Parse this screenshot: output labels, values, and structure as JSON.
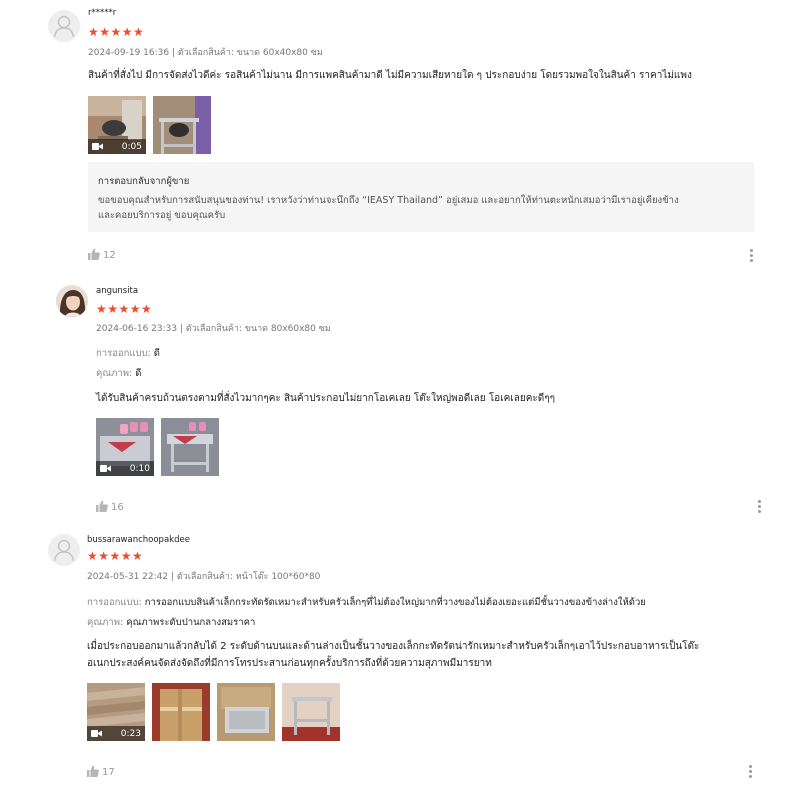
{
  "reviews": [
    {
      "username": "r*****r",
      "stars": "★★★★★",
      "meta": "2024-09-19 16:36 | ตัวเลือกสินค้า: ขนาด 60x40x80 ซม",
      "text": "สินค้าที่สั่งไป มีการจัดส่งไวดีค่ะ รอสินค้าไม่นาน มีการแพคสินค้ามาดี ไม่มีความเสียหายใด ๆ ประกอบง่าย โดยรวมพอใจในสินค้า ราคาไม่แพง",
      "video_duration": "0:05",
      "seller_reply": {
        "title": "การตอบกลับจากผู้ขาย",
        "line1": "ขอขอบคุณสำหรับการสนับสนุนของท่าน! เราหวังว่าท่านจะนึกถึง “IEASY Thailand” อยู่เสมอ และอยากให้ท่านตะหนักเสมอว่ามีเราอยู่เคียงข้าง",
        "line2": "และคอยบริการอยู่ ขอบคุณครับ"
      },
      "likes": "12"
    },
    {
      "username": "angunsita",
      "stars": "★★★★★",
      "meta": "2024-06-16 23:33 | ตัวเลือกสินค้า: ขนาด 80x60x80 ซม",
      "attributes": [
        {
          "label": "การออกแบบ:",
          "value": "ดี"
        },
        {
          "label": "คุณภาพ:",
          "value": "ดี"
        }
      ],
      "text": "ได้รับสินค้าครบถ้วนตรงตามที่สั่งไวมากๆคะ สินค้าประกอบไม่ยากโอเคเลย โต๊ะใหญ่พอดีเลย โอเคเลยคะดีๆๆ",
      "video_duration": "0:10",
      "likes": "16"
    },
    {
      "username": "bussarawanchoopakdee",
      "stars": "★★★★★",
      "meta": "2024-05-31 22:42 | ตัวเลือกสินค้า: หน้าโต๊ะ 100*60*80",
      "attributes": [
        {
          "label": "การออกแบบ:",
          "value": "การออกแบบสินค้าเล็กกระทัดรัดเหมาะสำหรับครัวเล็กๆที่ไม่ต้องใหญ่มากที่วางของไม่ต้องเยอะแต่มีชั้นวางของข้างล่างให้ด้วย"
        },
        {
          "label": "คุณภาพ:",
          "value": "คุณภาพระดับปานกลางสมราคา"
        }
      ],
      "text_line1": "เมื่อประกอบออกมาแล้วกลับได้ 2 ระดับด้านบนและด้านล่างเป็นชั้นวางของเล็กกะทัดรัดน่ารักเหมาะสำหรับครัวเล็กๆเอาไว้ประกอบอาหารเป็นโต๊ะ",
      "text_line2": "อเนกประสงค์คนจัดส่งจัดถึงที่มีการโทรประสานก่อนทุกครั้งบริการถึงที่ด้วยความสุภาพมีมารยาท",
      "video_duration": "0:23",
      "likes": "17"
    }
  ],
  "colors": {
    "star": "#ee4d2d",
    "reply_bg": "#f5f5f5",
    "muted": "#888888"
  },
  "icons": {
    "avatar_placeholder": "user-silhouette-icon",
    "like": "thumbs-up-icon",
    "video": "video-camera-icon",
    "more": "more-vertical-icon"
  }
}
